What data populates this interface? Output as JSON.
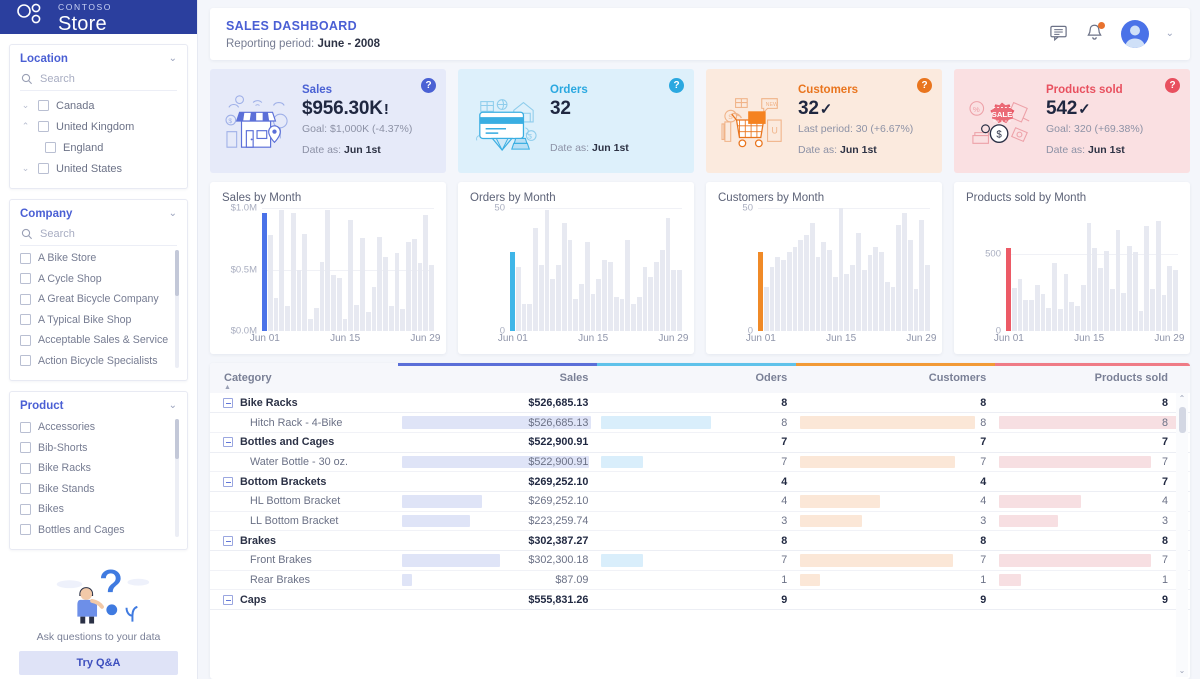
{
  "brand": {
    "sub": "CONTOSO",
    "name": "Store",
    "logo_icon": "contoso-logo-icon"
  },
  "sidebar": {
    "location": {
      "title": "Location",
      "chevron": "chevron-down-icon",
      "search_placeholder": "Search",
      "items": [
        {
          "label": "Canada",
          "twisty": "chevron-down-icon",
          "indent": false
        },
        {
          "label": "United Kingdom",
          "twisty": "chevron-up-icon",
          "indent": false
        },
        {
          "label": "England",
          "twisty": "",
          "indent": true
        },
        {
          "label": "United States",
          "twisty": "chevron-down-icon",
          "indent": false
        }
      ]
    },
    "company": {
      "title": "Company",
      "chevron": "chevron-down-icon",
      "search_placeholder": "Search",
      "items": [
        "A Bike Store",
        "A Cycle Shop",
        "A Great Bicycle Company",
        "A Typical Bike Shop",
        "Acceptable Sales & Service",
        "Action Bicycle Specialists"
      ]
    },
    "product": {
      "title": "Product",
      "chevron": "chevron-down-icon",
      "items": [
        "Accessories",
        "Bib-Shorts",
        "Bike Racks",
        "Bike Stands",
        "Bikes",
        "Bottles and Cages"
      ]
    },
    "qna": {
      "art_icon": "question-person-icon",
      "text": "Ask questions to your data",
      "button": "Try Q&A"
    }
  },
  "header": {
    "title": "SALES DASHBOARD",
    "period_label": "Reporting period:",
    "period_value": "June - 2008",
    "icons": {
      "comment": "comment-icon",
      "bell": "bell-icon",
      "avatar": "user-avatar-icon",
      "chevron": "chevron-down-icon"
    }
  },
  "kpis": [
    {
      "key": "sales",
      "label": "Sales",
      "value": "$956.30K",
      "mark": "!",
      "sub": "Goal: $1,000K (-4.37%)",
      "date_label": "Date as:",
      "date_value": "Jun 1st",
      "bg": "#e6eaf9",
      "accent": "#4a61d4",
      "help_icon": "help-icon",
      "art_icon": "storefront-illustration-icon"
    },
    {
      "key": "orders",
      "label": "Orders",
      "value": "32",
      "mark": "",
      "sub": "",
      "date_label": "Date as:",
      "date_value": "Jun 1st",
      "bg": "#ddf0fb",
      "accent": "#2aa8e0",
      "help_icon": "help-icon",
      "art_icon": "credit-card-illustration-icon"
    },
    {
      "key": "customers",
      "label": "Customers",
      "value": "32",
      "mark": "✓",
      "sub": "Last period: 30 (+6.67%)",
      "date_label": "Date as:",
      "date_value": "Jun 1st",
      "bg": "#fbeade",
      "accent": "#e9751e",
      "help_icon": "help-icon",
      "art_icon": "shopping-cart-illustration-icon"
    },
    {
      "key": "products_sold",
      "label": "Products sold",
      "value": "542",
      "mark": "✓",
      "sub": "Goal: 320 (+69.38%)",
      "date_label": "Date as:",
      "date_value": "Jun 1st",
      "bg": "#fae0e2",
      "accent": "#e8505f",
      "help_icon": "help-icon",
      "art_icon": "sale-tag-illustration-icon"
    }
  ],
  "chart_data": [
    {
      "type": "bar",
      "key": "sales",
      "title": "Sales by Month",
      "xlabel": "",
      "ylabel": "",
      "ylim": [
        0,
        1000000
      ],
      "ytick_labels": [
        "$1.0M",
        "$0.5M",
        "$0.0M"
      ],
      "ytick_values": [
        1000000,
        500000,
        0
      ],
      "xtick_labels": [
        "Jun 01",
        "Jun 15",
        "Jun 29"
      ],
      "xtick_index": [
        0,
        14,
        28
      ],
      "grid": true,
      "highlight_index": 0,
      "highlight_color": "#4a72e8",
      "bar_color": "#e7e9f1",
      "categories": [
        "Jun 01",
        "Jun 02",
        "Jun 03",
        "Jun 04",
        "Jun 05",
        "Jun 06",
        "Jun 07",
        "Jun 08",
        "Jun 09",
        "Jun 10",
        "Jun 11",
        "Jun 12",
        "Jun 13",
        "Jun 14",
        "Jun 15",
        "Jun 16",
        "Jun 17",
        "Jun 18",
        "Jun 19",
        "Jun 20",
        "Jun 21",
        "Jun 22",
        "Jun 23",
        "Jun 24",
        "Jun 25",
        "Jun 26",
        "Jun 27",
        "Jun 28",
        "Jun 29",
        "Jun 30"
      ],
      "values": [
        956300,
        780000,
        270000,
        985000,
        205000,
        960000,
        500000,
        790000,
        100000,
        185000,
        565000,
        985000,
        455000,
        430000,
        95000,
        900000,
        215000,
        755000,
        155000,
        360000,
        765000,
        600000,
        200000,
        635000,
        175000,
        725000,
        745000,
        555000,
        945000,
        535000
      ]
    },
    {
      "type": "bar",
      "key": "orders",
      "title": "Orders by Month",
      "xlabel": "",
      "ylabel": "",
      "ylim": [
        0,
        50
      ],
      "ytick_labels": [
        "50",
        "0"
      ],
      "ytick_values": [
        50,
        0
      ],
      "xtick_labels": [
        "Jun 01",
        "Jun 15",
        "Jun 29"
      ],
      "xtick_index": [
        0,
        14,
        28
      ],
      "grid": true,
      "highlight_index": 0,
      "highlight_color": "#3fb6e8",
      "bar_color": "#e7e9f1",
      "categories": [
        "Jun 01",
        "Jun 02",
        "Jun 03",
        "Jun 04",
        "Jun 05",
        "Jun 06",
        "Jun 07",
        "Jun 08",
        "Jun 09",
        "Jun 10",
        "Jun 11",
        "Jun 12",
        "Jun 13",
        "Jun 14",
        "Jun 15",
        "Jun 16",
        "Jun 17",
        "Jun 18",
        "Jun 19",
        "Jun 20",
        "Jun 21",
        "Jun 22",
        "Jun 23",
        "Jun 24",
        "Jun 25",
        "Jun 26",
        "Jun 27",
        "Jun 28",
        "Jun 29",
        "Jun 30"
      ],
      "values": [
        32,
        26,
        11,
        11,
        42,
        27,
        49,
        21,
        27,
        44,
        37,
        13,
        19,
        36,
        15,
        21,
        29,
        28,
        14,
        13,
        37,
        11,
        14,
        26,
        22,
        28,
        33,
        46,
        25,
        25
      ]
    },
    {
      "type": "bar",
      "key": "customers",
      "title": "Customers by Month",
      "xlabel": "",
      "ylabel": "",
      "ylim": [
        0,
        50
      ],
      "ytick_labels": [
        "50",
        "0"
      ],
      "ytick_values": [
        50,
        0
      ],
      "xtick_labels": [
        "Jun 01",
        "Jun 15",
        "Jun 29"
      ],
      "xtick_index": [
        0,
        14,
        28
      ],
      "grid": true,
      "highlight_index": 0,
      "highlight_color": "#f08a27",
      "bar_color": "#e7e9f1",
      "categories": [
        "Jun 01",
        "Jun 02",
        "Jun 03",
        "Jun 04",
        "Jun 05",
        "Jun 06",
        "Jun 07",
        "Jun 08",
        "Jun 09",
        "Jun 10",
        "Jun 11",
        "Jun 12",
        "Jun 13",
        "Jun 14",
        "Jun 15",
        "Jun 16",
        "Jun 17",
        "Jun 18",
        "Jun 19",
        "Jun 20",
        "Jun 21",
        "Jun 22",
        "Jun 23",
        "Jun 24",
        "Jun 25",
        "Jun 26",
        "Jun 27",
        "Jun 28",
        "Jun 29",
        "Jun 30"
      ],
      "values": [
        32,
        18,
        26,
        30,
        29,
        32,
        34,
        37,
        39,
        44,
        30,
        36,
        33,
        22,
        50,
        23,
        27,
        40,
        25,
        31,
        34,
        32,
        20,
        18,
        43,
        48,
        37,
        17,
        45,
        27
      ]
    },
    {
      "type": "bar",
      "key": "products_sold",
      "title": "Products sold by Month",
      "xlabel": "",
      "ylabel": "",
      "ylim": [
        0,
        800
      ],
      "ytick_labels": [
        "500",
        "0"
      ],
      "ytick_values": [
        500,
        0
      ],
      "xtick_labels": [
        "Jun 01",
        "Jun 15",
        "Jun 29"
      ],
      "xtick_index": [
        0,
        14,
        28
      ],
      "grid": true,
      "highlight_index": 0,
      "highlight_color": "#ec5a66",
      "bar_color": "#e7e9f1",
      "categories": [
        "Jun 01",
        "Jun 02",
        "Jun 03",
        "Jun 04",
        "Jun 05",
        "Jun 06",
        "Jun 07",
        "Jun 08",
        "Jun 09",
        "Jun 10",
        "Jun 11",
        "Jun 12",
        "Jun 13",
        "Jun 14",
        "Jun 15",
        "Jun 16",
        "Jun 17",
        "Jun 18",
        "Jun 19",
        "Jun 20",
        "Jun 21",
        "Jun 22",
        "Jun 23",
        "Jun 24",
        "Jun 25",
        "Jun 26",
        "Jun 27",
        "Jun 28",
        "Jun 29",
        "Jun 30"
      ],
      "values": [
        542,
        280,
        340,
        200,
        200,
        300,
        240,
        150,
        440,
        145,
        370,
        190,
        160,
        300,
        700,
        540,
        410,
        520,
        275,
        660,
        250,
        555,
        515,
        130,
        680,
        275,
        715,
        235,
        420,
        400
      ]
    }
  ],
  "table": {
    "columns": [
      {
        "key": "category",
        "label": "Category",
        "accent": "#f6f7fb",
        "sort": "asc",
        "align": "left"
      },
      {
        "key": "sales",
        "label": "Sales",
        "accent": "#5b6fd8",
        "bar": "#dfe4f7",
        "align": "right"
      },
      {
        "key": "orders",
        "label": "Oders",
        "accent": "#5fc2ea",
        "bar": "#d9eefb",
        "align": "right"
      },
      {
        "key": "customers",
        "label": "Customers",
        "accent": "#f29a36",
        "bar": "#fbe7d7",
        "align": "right"
      },
      {
        "key": "products_sold",
        "label": "Products sold",
        "accent": "#ef7b86",
        "bar": "#f7dfe2",
        "align": "right"
      }
    ],
    "rows": [
      {
        "type": "group",
        "category": "Bike Racks",
        "sales": "$526,685.13",
        "orders": "8",
        "customers": "8",
        "products_sold": "8",
        "sales_pct": 0,
        "orders_pct": 0,
        "customers_pct": 0,
        "products_pct": 0
      },
      {
        "type": "child",
        "category": "Hitch Rack - 4-Bike",
        "sales": "$526,685.13",
        "orders": "8",
        "customers": "8",
        "products_sold": "8",
        "sales_pct": 95,
        "orders_pct": 55,
        "customers_pct": 88,
        "products_pct": 94
      },
      {
        "type": "group",
        "category": "Bottles and Cages",
        "sales": "$522,900.91",
        "orders": "7",
        "customers": "7",
        "products_sold": "7",
        "sales_pct": 0,
        "orders_pct": 0,
        "customers_pct": 0,
        "products_pct": 0
      },
      {
        "type": "child",
        "category": "Water Bottle - 30 oz.",
        "sales": "$522,900.91",
        "orders": "7",
        "customers": "7",
        "products_sold": "7",
        "sales_pct": 94,
        "orders_pct": 21,
        "customers_pct": 78,
        "products_pct": 78
      },
      {
        "type": "group",
        "category": "Bottom Brackets",
        "sales": "$269,252.10",
        "orders": "4",
        "customers": "4",
        "products_sold": "7",
        "sales_pct": 0,
        "orders_pct": 0,
        "customers_pct": 0,
        "products_pct": 0
      },
      {
        "type": "child",
        "category": "HL Bottom Bracket",
        "sales": "$269,252.10",
        "orders": "4",
        "customers": "4",
        "products_sold": "4",
        "sales_pct": 40,
        "orders_pct": 0,
        "customers_pct": 40,
        "products_pct": 42
      },
      {
        "type": "child",
        "category": "LL Bottom Bracket",
        "sales": "$223,259.74",
        "orders": "3",
        "customers": "3",
        "products_sold": "3",
        "sales_pct": 34,
        "orders_pct": 0,
        "customers_pct": 31,
        "products_pct": 30
      },
      {
        "type": "group",
        "category": "Brakes",
        "sales": "$302,387.27",
        "orders": "8",
        "customers": "8",
        "products_sold": "8",
        "sales_pct": 0,
        "orders_pct": 0,
        "customers_pct": 0,
        "products_pct": 0
      },
      {
        "type": "child",
        "category": "Front Brakes",
        "sales": "$302,300.18",
        "orders": "7",
        "customers": "7",
        "products_sold": "7",
        "sales_pct": 49,
        "orders_pct": 21,
        "customers_pct": 77,
        "products_pct": 78
      },
      {
        "type": "child",
        "category": "Rear Brakes",
        "sales": "$87.09",
        "orders": "1",
        "customers": "1",
        "products_sold": "1",
        "sales_pct": 5,
        "orders_pct": 0,
        "customers_pct": 10,
        "products_pct": 11
      },
      {
        "type": "group",
        "category": "Caps",
        "sales": "$555,831.26",
        "orders": "9",
        "customers": "9",
        "products_sold": "9",
        "sales_pct": 0,
        "orders_pct": 0,
        "customers_pct": 0,
        "products_pct": 0
      }
    ],
    "scroll_up_icon": "chevron-up-icon",
    "scroll_down_icon": "chevron-down-icon"
  }
}
